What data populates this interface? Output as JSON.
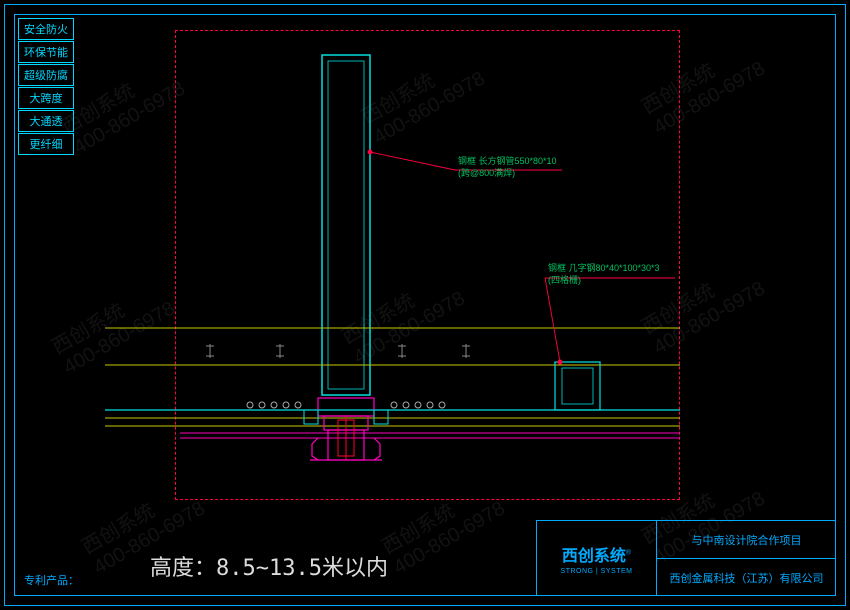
{
  "sidebar": {
    "tags": [
      "安全防火",
      "环保节能",
      "超级防腐",
      "大跨度",
      "大通透",
      "更纤细"
    ]
  },
  "annotations": {
    "main_profile": {
      "label1": "钢框 长方钢管550*80*10",
      "label2": "(跨@800满焊)"
    },
    "sub_profile": {
      "label1": "钢框 几字钢80*40*100*30*3",
      "label2": "(四格栅)"
    }
  },
  "height": "高度：8.5~13.5米以内",
  "patent": "专利产品：",
  "titleblock": {
    "logo_main": "西创系统",
    "logo_sub": "STRONG | SYSTEM",
    "logo_r": "®",
    "project": "与中南设计院合作项目",
    "company": "西创金属科技（江苏）有限公司"
  },
  "watermark": "西创系统\n400-860-6978",
  "colors": {
    "frame": "#00aaff",
    "cyan": "#00e0e0",
    "yellow": "#c8c800",
    "red": "#ff0040",
    "magenta": "#ff00c0",
    "green": "#00c060"
  }
}
